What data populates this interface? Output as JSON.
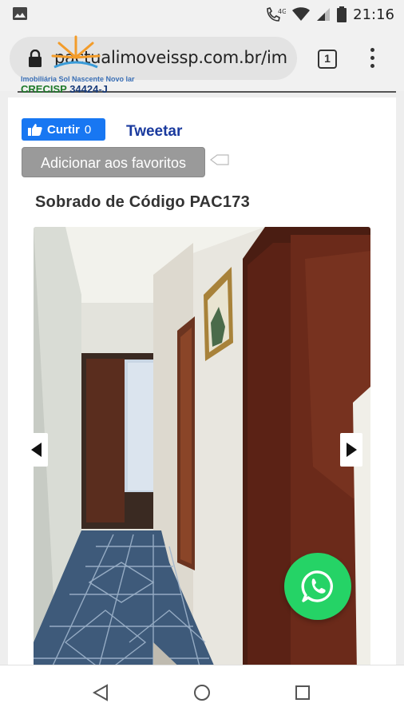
{
  "status_bar": {
    "time": "21:16",
    "network": "4G",
    "icons": [
      "image-icon",
      "call-icon",
      "wifi-icon",
      "signal-icon",
      "battery-icon"
    ]
  },
  "browser": {
    "url": "pactualimoveissp.com.br/im",
    "tab_count": "1",
    "icons": [
      "lock-icon",
      "tabs-icon",
      "menu-dots-icon"
    ]
  },
  "logo": {
    "tagline": "Imobiliária Sol Nascente Novo lar",
    "creci_label": "CRECISP",
    "creci_code": "34424-J"
  },
  "social": {
    "like_label": "Curtir",
    "like_count": "0",
    "tweet_label": "Tweetar"
  },
  "favorites": {
    "button_label": "Adicionar aos favoritos"
  },
  "listing": {
    "title": "Sobrado de Código PAC173"
  },
  "carousel": {
    "prev_icon": "triangle-left-icon",
    "next_icon": "triangle-right-icon"
  },
  "whatsapp": {
    "icon": "whatsapp-icon",
    "color": "#25d366"
  },
  "colors": {
    "facebook": "#1877f2",
    "tweet_link": "#1a3a9e",
    "fav_button": "#9a9a9a"
  },
  "system_nav": {
    "icons": [
      "back-icon",
      "home-icon",
      "recents-icon"
    ]
  }
}
